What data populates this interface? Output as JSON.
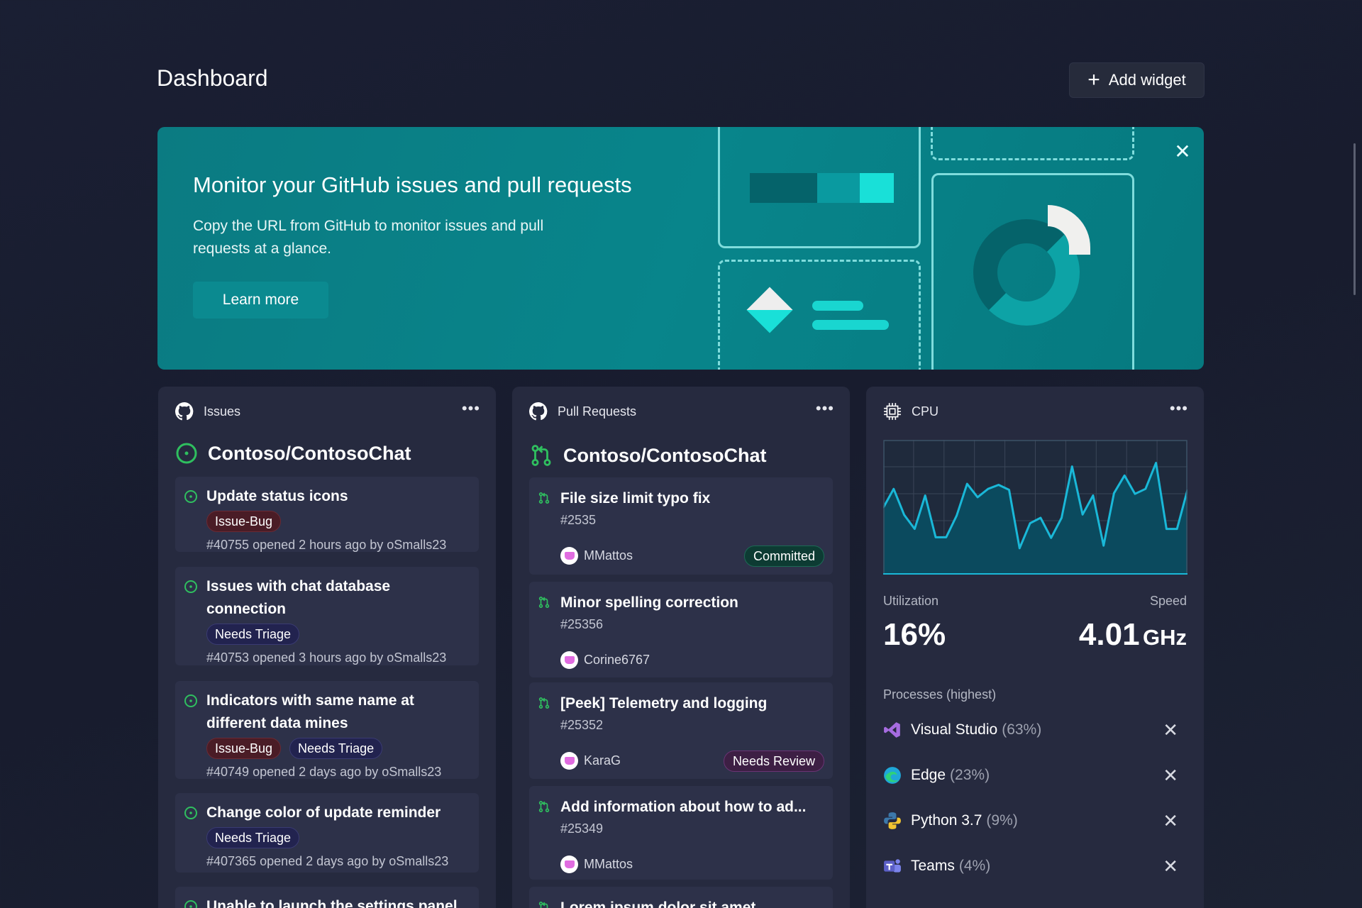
{
  "header": {
    "title": "Dashboard",
    "add_widget_label": "Add widget"
  },
  "banner": {
    "title": "Monitor your GitHub issues and pull requests",
    "description": "Copy the URL from GitHub to monitor issues and pull requests at a glance.",
    "learn_more_label": "Learn more"
  },
  "issues": {
    "widget_title": "Issues",
    "repo": "Contoso/ContosoChat",
    "items": [
      {
        "title": "Update status icons",
        "tags": [
          "Issue-Bug"
        ],
        "meta": "#40755 opened 2 hours ago by oSmalls23"
      },
      {
        "title": "Issues with chat database connection",
        "tags": [
          "Needs Triage"
        ],
        "meta": "#40753 opened 3 hours ago by oSmalls23"
      },
      {
        "title": "Indicators with same name at different data mines",
        "tags": [
          "Issue-Bug",
          "Needs Triage"
        ],
        "meta": "#40749 opened 2 days ago by oSmalls23"
      },
      {
        "title": "Change color of update reminder",
        "tags": [
          "Needs Triage"
        ],
        "meta": "#407365 opened 2 days ago by oSmalls23"
      },
      {
        "title": "Unable to launch the settings panel"
      }
    ]
  },
  "pulls": {
    "widget_title": "Pull Requests",
    "repo": "Contoso/ContosoChat",
    "items": [
      {
        "title": "File size limit typo fix",
        "number": "#2535",
        "author": "MMattos",
        "badge": "Committed"
      },
      {
        "title": "Minor spelling correction",
        "number": "#25356",
        "author": "Corine6767"
      },
      {
        "title": "[Peek] Telemetry and logging",
        "number": "#25352",
        "author": "KaraG",
        "badge": "Needs Review"
      },
      {
        "title": "Add information about how to ad...",
        "number": "#25349",
        "author": "MMattos"
      },
      {
        "title": "Lorem ipsum dolor sit amet"
      }
    ]
  },
  "cpu": {
    "widget_title": "CPU",
    "utilization_label": "Utilization",
    "utilization": "16%",
    "speed_label": "Speed",
    "speed_value": "4.01",
    "speed_unit": "GHz",
    "processes_label": "Processes (highest)",
    "processes": [
      {
        "name": "Visual Studio",
        "pct": "(63%)",
        "icon": "visual-studio-icon",
        "color": "#a66ce0"
      },
      {
        "name": "Edge",
        "pct": "(23%)",
        "icon": "edge-icon",
        "color": "#1fa7d8"
      },
      {
        "name": "Python 3.7",
        "pct": "(9%)",
        "icon": "python-icon",
        "color": "#f2c531"
      },
      {
        "name": "Teams",
        "pct": "(4%)",
        "icon": "teams-icon",
        "color": "#5b5fc7"
      }
    ]
  },
  "chart_data": {
    "type": "area",
    "ylim": [
      0,
      100
    ],
    "grid": true,
    "color": "#1ab8d8",
    "values": [
      49.5,
      63.6,
      44.3,
      33.9,
      58.7,
      27.7,
      27.7,
      43.8,
      67.3,
      57.4,
      63.6,
      66.6,
      62.9,
      19.6,
      38.1,
      42.1,
      27.2,
      42.1,
      80.2,
      44.6,
      58.7,
      21.5,
      60.4,
      73.5,
      59.9,
      63.6,
      82.9,
      33.9,
      33.9,
      62.9
    ]
  },
  "colors": {
    "accent_teal": "#08858b",
    "open_green": "#2fbf5f"
  }
}
